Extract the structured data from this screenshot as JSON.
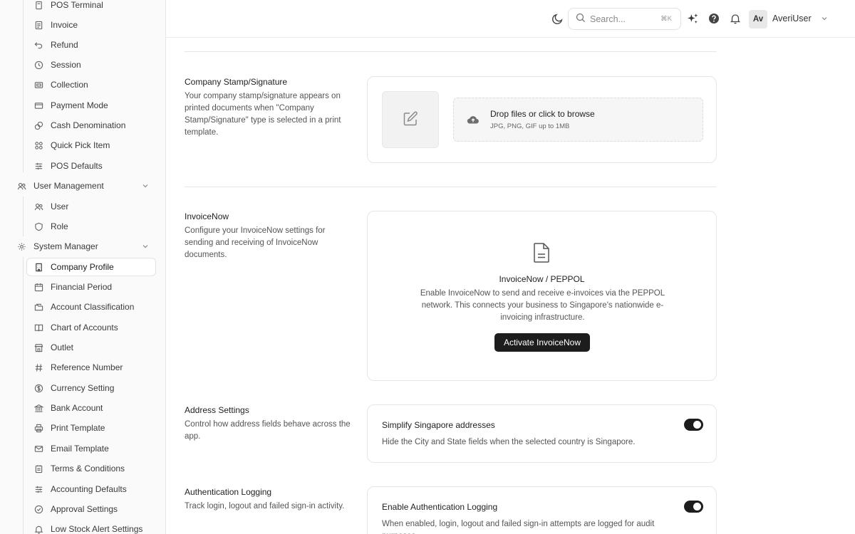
{
  "sidebar": {
    "pos_items": [
      {
        "label": "POS Terminal",
        "icon": "terminal-icon"
      },
      {
        "label": "Invoice",
        "icon": "invoice-icon"
      },
      {
        "label": "Refund",
        "icon": "refund-icon"
      },
      {
        "label": "Session",
        "icon": "clock-icon"
      },
      {
        "label": "Collection",
        "icon": "wallet-icon"
      },
      {
        "label": "Payment Mode",
        "icon": "card-icon"
      },
      {
        "label": "Cash Denomination",
        "icon": "coins-icon"
      },
      {
        "label": "Quick Pick Item",
        "icon": "grid-icon"
      },
      {
        "label": "POS Defaults",
        "icon": "sliders-icon"
      }
    ],
    "user_management": {
      "label": "User Management",
      "items": [
        {
          "label": "User",
          "icon": "users-icon"
        },
        {
          "label": "Role",
          "icon": "shield-icon"
        }
      ]
    },
    "system_manager": {
      "label": "System Manager",
      "items": [
        {
          "label": "Company Profile",
          "icon": "building-icon"
        },
        {
          "label": "Financial Period",
          "icon": "calendar-icon"
        },
        {
          "label": "Account Classification",
          "icon": "folder-icon"
        },
        {
          "label": "Chart of Accounts",
          "icon": "book-icon"
        },
        {
          "label": "Outlet",
          "icon": "store-icon"
        },
        {
          "label": "Reference Number",
          "icon": "hash-icon"
        },
        {
          "label": "Currency Setting",
          "icon": "currency-icon"
        },
        {
          "label": "Bank Account",
          "icon": "bank-icon"
        },
        {
          "label": "Print Template",
          "icon": "printer-icon"
        },
        {
          "label": "Email Template",
          "icon": "mail-icon"
        },
        {
          "label": "Terms & Conditions",
          "icon": "document-icon"
        },
        {
          "label": "Accounting Defaults",
          "icon": "sliders-icon"
        },
        {
          "label": "Approval Settings",
          "icon": "check-circle-icon"
        },
        {
          "label": "Low Stock Alert Settings",
          "icon": "bell-icon"
        }
      ]
    }
  },
  "topbar": {
    "search_placeholder": "Search...",
    "search_shortcut": "⌘K",
    "avatar_initials": "Av",
    "username": "AveriUser"
  },
  "sections": {
    "stamp": {
      "title": "Company Stamp/Signature",
      "description": "Your company stamp/signature appears on printed documents when \"Company Stamp/Signature\" type is selected in a print template.",
      "dropzone_title": "Drop files or click to browse",
      "dropzone_hint": "JPG, PNG, GIF up to 1MB"
    },
    "invoicenow": {
      "title": "InvoiceNow",
      "description": "Configure your InvoiceNow settings for sending and receiving of InvoiceNow documents.",
      "card_title": "InvoiceNow / PEPPOL",
      "card_description": "Enable InvoiceNow to send and receive e-invoices via the PEPPOL network. This connects your business to Singapore's nationwide e-invoicing infrastructure.",
      "button_label": "Activate InvoiceNow"
    },
    "address": {
      "title": "Address Settings",
      "description": "Control how address fields behave across the app.",
      "setting_title": "Simplify Singapore addresses",
      "setting_description": "Hide the City and State fields when the selected country is Singapore.",
      "enabled": true
    },
    "auth": {
      "title": "Authentication Logging",
      "description": "Track login, logout and failed sign-in activity.",
      "setting_title": "Enable Authentication Logging",
      "setting_description": "When enabled, login, logout and failed sign-in attempts are logged for audit purposes.",
      "enabled": true
    }
  }
}
